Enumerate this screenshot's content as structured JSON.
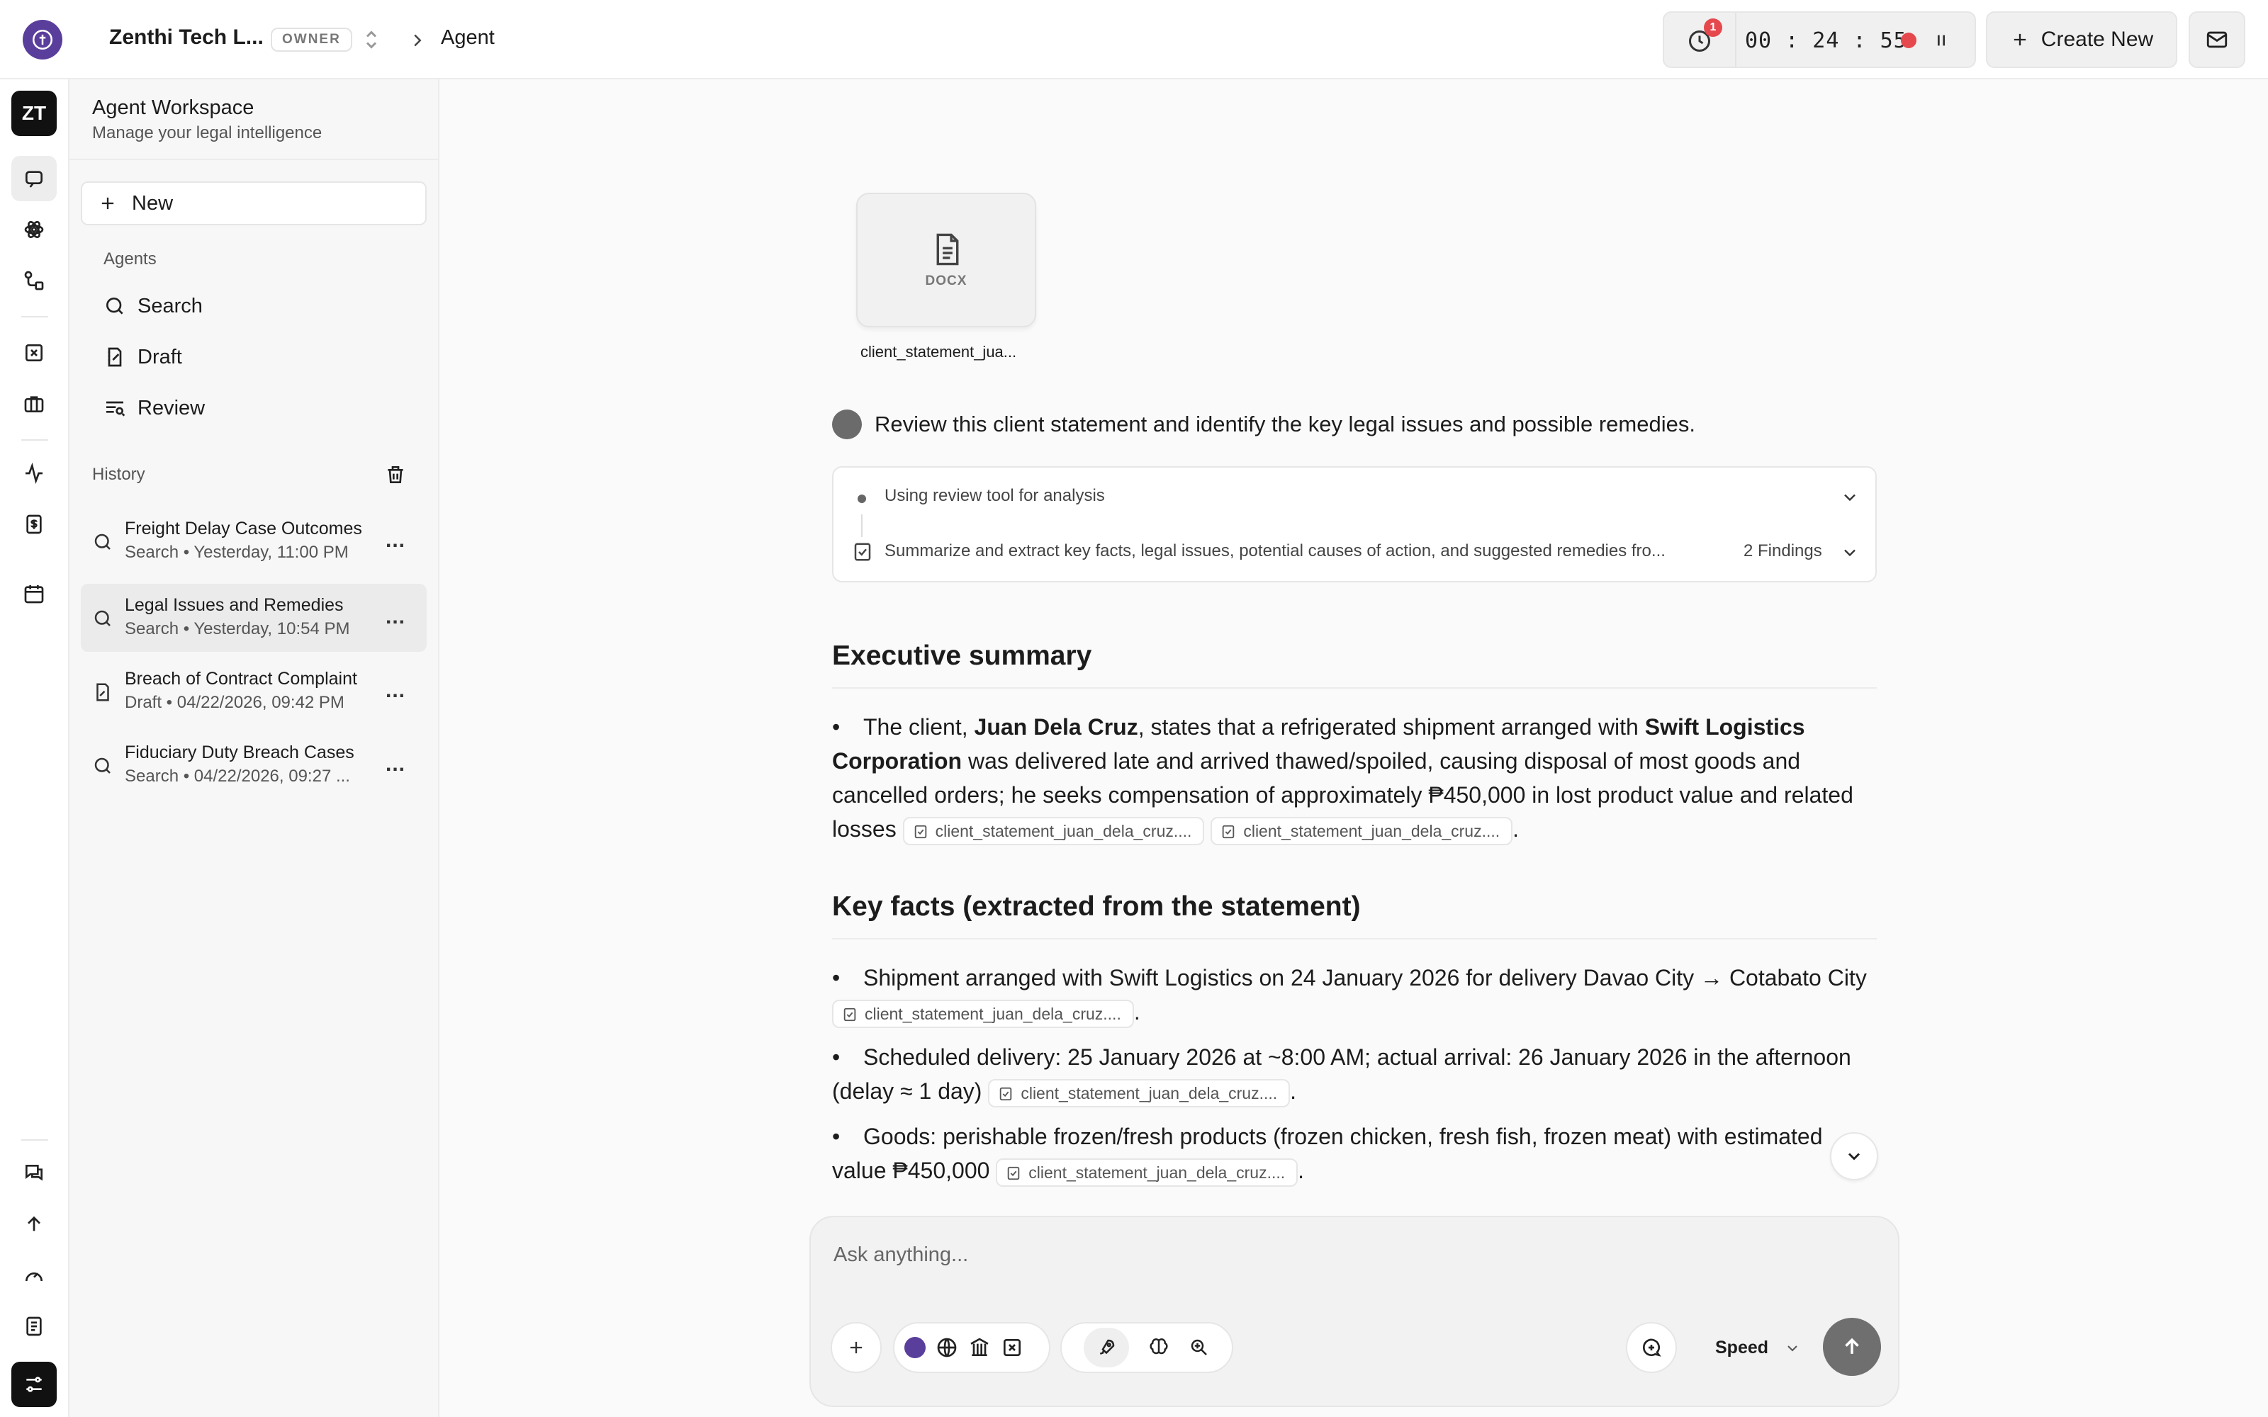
{
  "topbar": {
    "workspace_name": "Zenthi Tech L...",
    "role_badge": "OWNER",
    "breadcrumb": "Agent",
    "notification_count": "1",
    "timer": "00 : 24 : 55",
    "create_new": "Create New"
  },
  "rail": {
    "avatar_initials": "ZT"
  },
  "sidebar": {
    "title": "Agent Workspace",
    "subtitle": "Manage your legal intelligence",
    "new_label": "New",
    "agents_label": "Agents",
    "agents": [
      {
        "label": "Search",
        "icon": "search-icon"
      },
      {
        "label": "Draft",
        "icon": "draft-icon"
      },
      {
        "label": "Review",
        "icon": "review-icon"
      }
    ],
    "history_label": "History",
    "history": [
      {
        "title": "Freight Delay Case Outcomes",
        "meta": "Search • Yesterday, 11:00 PM",
        "icon": "search-icon"
      },
      {
        "title": "Legal Issues and Remedies",
        "meta": "Search • Yesterday, 10:54 PM",
        "icon": "search-icon",
        "active": true
      },
      {
        "title": "Breach of Contract Complaint",
        "meta": "Draft • 04/22/2026, 09:42 PM",
        "icon": "draft-doc-icon"
      },
      {
        "title": "Fiduciary Duty Breach Cases",
        "meta": "Search • 04/22/2026, 09:27 ...",
        "icon": "search-icon"
      }
    ],
    "more": "..."
  },
  "chat": {
    "attachment": {
      "type": "DOCX",
      "name": "client_statement_jua..."
    },
    "prompt": "Review this client statement and identify the key legal issues and possible remedies.",
    "tool_steps": [
      {
        "text": "Using review tool for analysis"
      },
      {
        "text": "Summarize and extract key facts, legal issues, potential causes of action, and suggested remedies fro...",
        "badge": "2 Findings"
      }
    ],
    "sections": [
      {
        "heading": "Executive summary",
        "bullet": {
          "t1": "The client, ",
          "b1": "Juan Dela Cruz",
          "t2": ", states that a refrigerated shipment arranged with ",
          "b2": "Swift Logistics Corporation",
          "t3": " was delivered late and arrived thawed/spoiled, causing disposal of most goods and cancelled orders; he seeks compensation of approximately ₱450,000 in lost product value and related losses",
          "cite1": "client_statement_juan_dela_cruz....",
          "cite2": "client_statement_juan_dela_cruz...."
        }
      },
      {
        "heading": "Key facts (extracted from the statement)",
        "bullets": [
          {
            "text": "Shipment arranged with Swift Logistics on 24 January 2026 for delivery Davao City → Cotabato City",
            "cite": "client_statement_juan_dela_cruz...."
          },
          {
            "text": "Scheduled delivery: 25 January 2026 at ~8:00 AM; actual arrival: 26 January 2026 in the afternoon (delay ≈ 1 day)",
            "cite": "client_statement_juan_dela_cruz...."
          },
          {
            "text": "Goods: perishable frozen/fresh products (frozen chicken, fresh fish, frozen meat) with estimated value ₱450,000",
            "cite": "client_statement_juan_dela_cruz...."
          }
        ]
      }
    ]
  },
  "composer": {
    "placeholder": "Ask anything...",
    "speed_label": "Speed"
  },
  "colors": {
    "brand": "#5a3e9c",
    "record": "#e5484d",
    "send": "#6f6f6f"
  }
}
